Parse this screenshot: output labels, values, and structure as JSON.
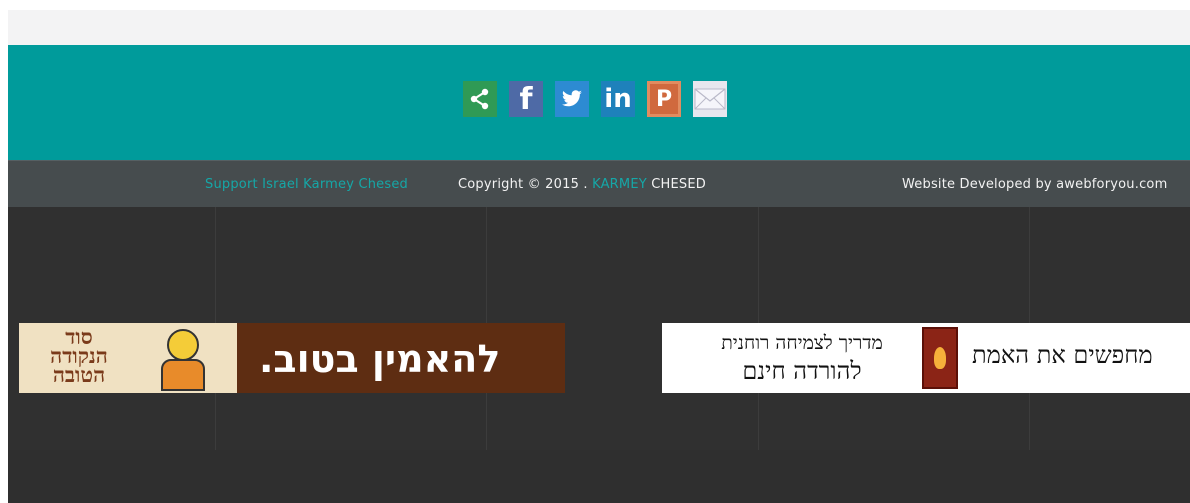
{
  "share": {
    "icons": [
      {
        "name": "share-icon",
        "glyph": "<"
      },
      {
        "name": "facebook-icon",
        "glyph": "f"
      },
      {
        "name": "twitter-icon",
        "glyph": "t"
      },
      {
        "name": "linkedin-icon",
        "glyph": "in"
      },
      {
        "name": "pinterest-icon",
        "glyph": "P"
      },
      {
        "name": "email-icon",
        "glyph": ""
      }
    ]
  },
  "footer": {
    "support_link": "Support Israel Karmey Chesed",
    "copyright_prefix": "Copyright © 2015 . ",
    "brand_part1": "KARMEY",
    "brand_part2": " CHESED",
    "developer": "Website Developed by awebforyou.com"
  },
  "banners": {
    "banner1": {
      "logo_line1": "סוד",
      "logo_line2": "הנקודה",
      "logo_line3": "הטובה",
      "text": "להאמין בטוב."
    },
    "banner2": {
      "line1": "מדריך לצמיחה רוחנית",
      "line2": "להורדה חינם",
      "title": "מחפשים את האמת"
    }
  },
  "colors": {
    "teal": "#009b9b",
    "accent": "#15a7a7",
    "footer_bar": "#464c4e",
    "dark": "#303030"
  }
}
